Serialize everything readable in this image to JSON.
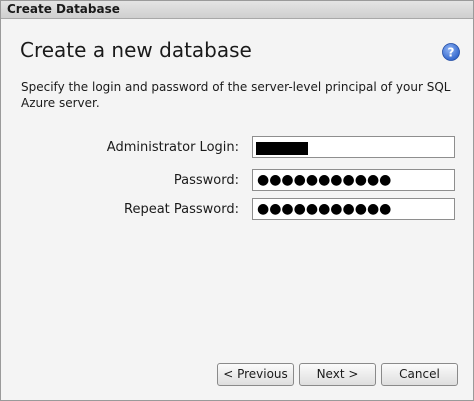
{
  "window": {
    "title": "Create Database"
  },
  "page": {
    "heading": "Create a new database",
    "description": "Specify the login and password of the server-level principal of your SQL Azure server."
  },
  "form": {
    "admin_login": {
      "label": "Administrator Login:",
      "value": ""
    },
    "password": {
      "label": "Password:",
      "value": "●●●●●●●●●●●"
    },
    "repeat_password": {
      "label": "Repeat Password:",
      "value": "●●●●●●●●●●●"
    }
  },
  "buttons": {
    "previous": "< Previous",
    "next": "Next >",
    "cancel": "Cancel"
  },
  "icons": {
    "help": "help-icon"
  },
  "colors": {
    "help_icon": "#3a6ccf"
  }
}
